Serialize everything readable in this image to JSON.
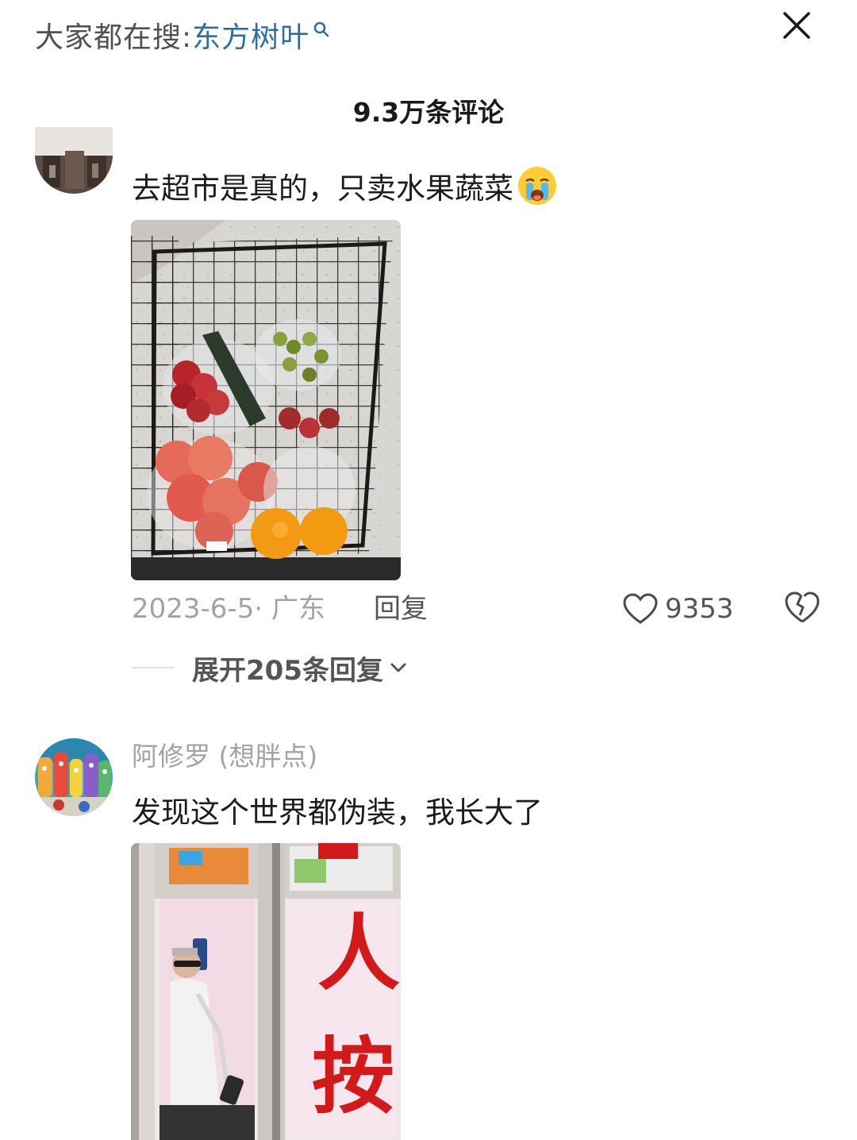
{
  "search_hint": {
    "prefix": "大家都在搜:",
    "term": "东方树叶"
  },
  "comments_header": {
    "count_label": "9.3万条评论"
  },
  "comments": [
    {
      "text": "去超市是真的，只卖水果蔬菜",
      "emoji": "crying-face-emoji",
      "date_location": "2023-6-5· 广东",
      "reply_label": "回复",
      "like_count": "9353",
      "expand_replies_label": "展开205条回复"
    },
    {
      "username": "阿修罗 (想胖点)",
      "text": "发现这个世界都伪装，我长大了"
    }
  ],
  "photo2_sign": {
    "char1": "人",
    "char2": "按"
  },
  "colors": {
    "accent_link": "#2e6ea6",
    "muted_text": "#a3a3a3",
    "body_text": "#1c1c1c",
    "secondary_text": "#555555",
    "sign_red": "#d31a1a"
  }
}
